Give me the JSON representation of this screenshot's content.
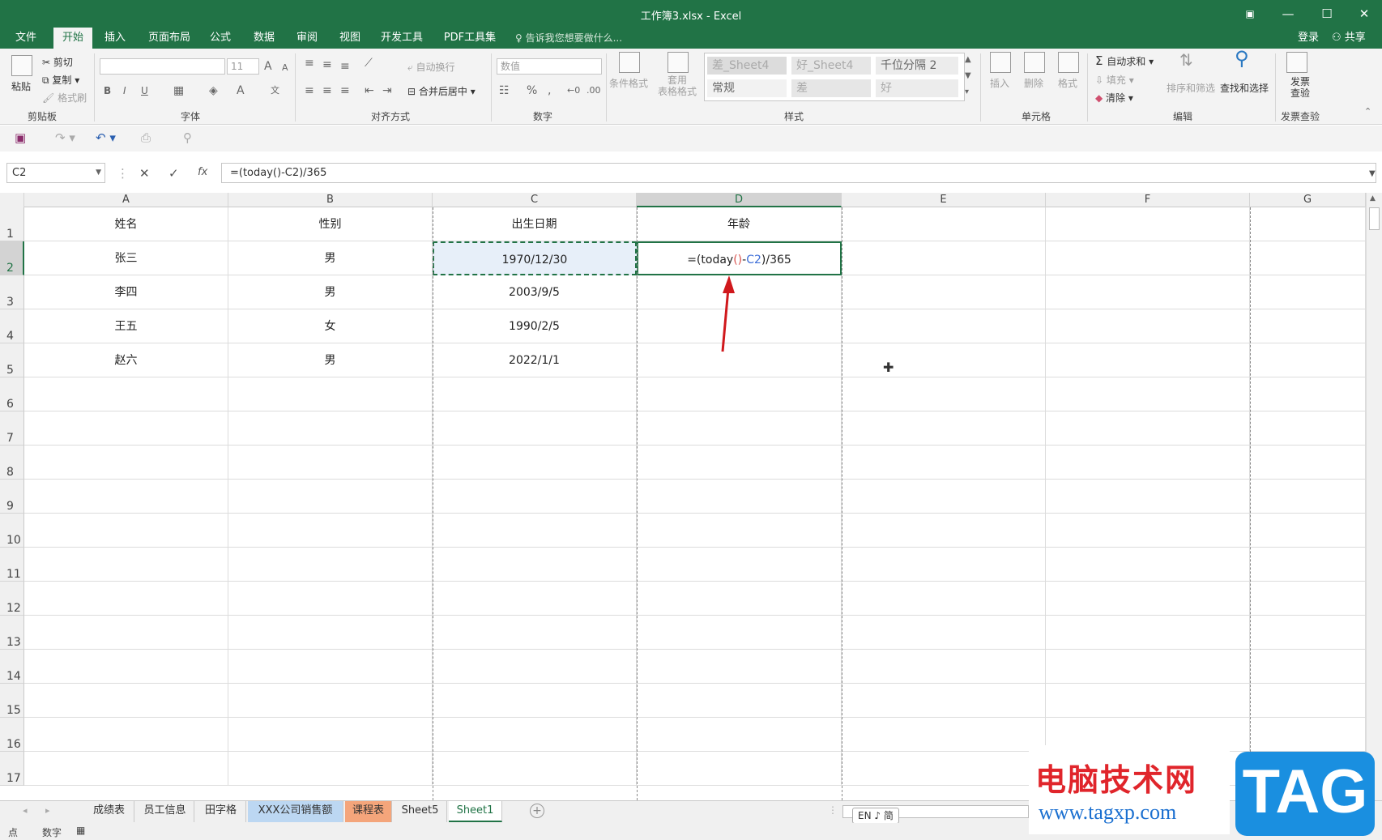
{
  "window": {
    "title": "工作簿3.xlsx - Excel",
    "buttons": [
      "▣",
      "—",
      "☐",
      "✕"
    ]
  },
  "menu": {
    "tabs": [
      "文件",
      "开始",
      "插入",
      "页面布局",
      "公式",
      "数据",
      "审阅",
      "视图",
      "开发工具",
      "PDF工具集"
    ],
    "active_tab": "开始",
    "tell_me": "告诉我您想要做什么...",
    "login": "登录",
    "share": "共享"
  },
  "ribbon": {
    "clipboard": {
      "label": "剪贴板",
      "paste": "粘贴",
      "cut": "剪切",
      "copy": "复制",
      "format_painter": "格式刷"
    },
    "font": {
      "label": "字体",
      "font_name": "",
      "font_size": "11",
      "bold": "B",
      "italic": "I",
      "underline": "U"
    },
    "alignment": {
      "label": "对齐方式",
      "wrap": "自动换行",
      "merge": "合并后居中"
    },
    "number": {
      "label": "数字",
      "format": "数值",
      "percent": "%",
      "comma": ","
    },
    "styles": {
      "label": "样式",
      "conditional": "条件格式",
      "table_format": "套用\n表格格式",
      "cells": [
        "差_Sheet4",
        "好_Sheet4",
        "千位分隔 2",
        "常规",
        "差",
        "好"
      ]
    },
    "cells_group": {
      "label": "单元格",
      "insert": "插入",
      "delete": "删除",
      "format": "格式"
    },
    "editing": {
      "label": "编辑",
      "autosum": "自动求和",
      "fill": "填充",
      "clear": "清除",
      "sort_filter": "排序和筛选",
      "find_select": "查找和选择"
    },
    "invoice": {
      "label": "发票查验",
      "button": "发票\n查验"
    }
  },
  "formula_bar": {
    "name_box": "C2",
    "formula": "=(today()-C2)/365",
    "cancel": "✕",
    "enter": "✓",
    "fx": "fx"
  },
  "grid": {
    "columns": [
      "A",
      "B",
      "C",
      "D",
      "E",
      "F",
      "G"
    ],
    "selected_column": "D",
    "rows": [
      "1",
      "2",
      "3",
      "4",
      "5",
      "6",
      "7",
      "8",
      "9",
      "10",
      "11",
      "12",
      "13",
      "14",
      "15",
      "16",
      "17"
    ],
    "selected_row": "2",
    "data": [
      [
        "姓名",
        "性别",
        "出生日期",
        "年龄"
      ],
      [
        "张三",
        "男",
        "1970/12/30",
        ""
      ],
      [
        "李四",
        "男",
        "2003/9/5",
        ""
      ],
      [
        "王五",
        "女",
        "1990/2/5",
        ""
      ],
      [
        "赵六",
        "男",
        "2022/1/1",
        ""
      ]
    ],
    "editing_cell": {
      "parts": [
        "=(today",
        "()",
        "-",
        "C2",
        ")/365"
      ],
      "colors": [
        "#222222",
        "#d9534f",
        "#222222",
        "#3e6fd8",
        "#222222"
      ]
    },
    "arrow_color": "#d0181c"
  },
  "sheets": {
    "tabs": [
      "成绩表",
      "员工信息",
      "田字格",
      "XXX公司销售额",
      "课程表",
      "Sheet5",
      "Sheet1"
    ],
    "active": "Sheet1",
    "tab_colors": [
      "",
      "",
      "",
      "#bcd7f2",
      "#f4a57b",
      "",
      ""
    ]
  },
  "status": {
    "mode": "点",
    "num": "数字",
    "ime": "EN ♪ 简"
  },
  "watermark": {
    "site_name": "电脑技术网",
    "url": "www.tagxp.com",
    "logo": "TAG"
  }
}
